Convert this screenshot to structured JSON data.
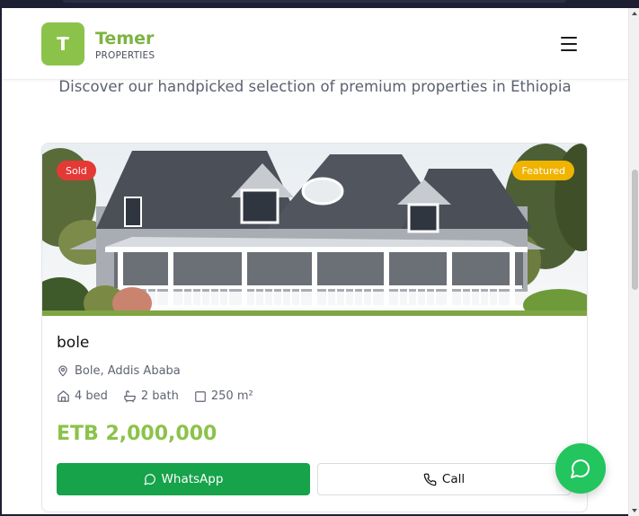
{
  "header": {
    "logo_letter": "T",
    "brand_name": "Temer",
    "brand_sub": "PROPERTIES",
    "menu_icon": "hamburger-menu-icon"
  },
  "section": {
    "subtitle": "Discover our handpicked selection of premium properties in Ethiopia"
  },
  "listing": {
    "status_badge": "Sold",
    "featured_badge": "Featured",
    "title": "bole",
    "location": "Bole, Addis Ababa",
    "beds": "4 bed",
    "baths": "2 bath",
    "area": "250 m²",
    "price": "ETB 2,000,000",
    "whatsapp_label": "WhatsApp",
    "call_label": "Call"
  },
  "colors": {
    "brand_green": "#8bc34a",
    "whatsapp_green": "#16a34a",
    "sold_red": "#e53935",
    "featured_yellow": "#f0b400",
    "fab_green": "#22c55e"
  }
}
